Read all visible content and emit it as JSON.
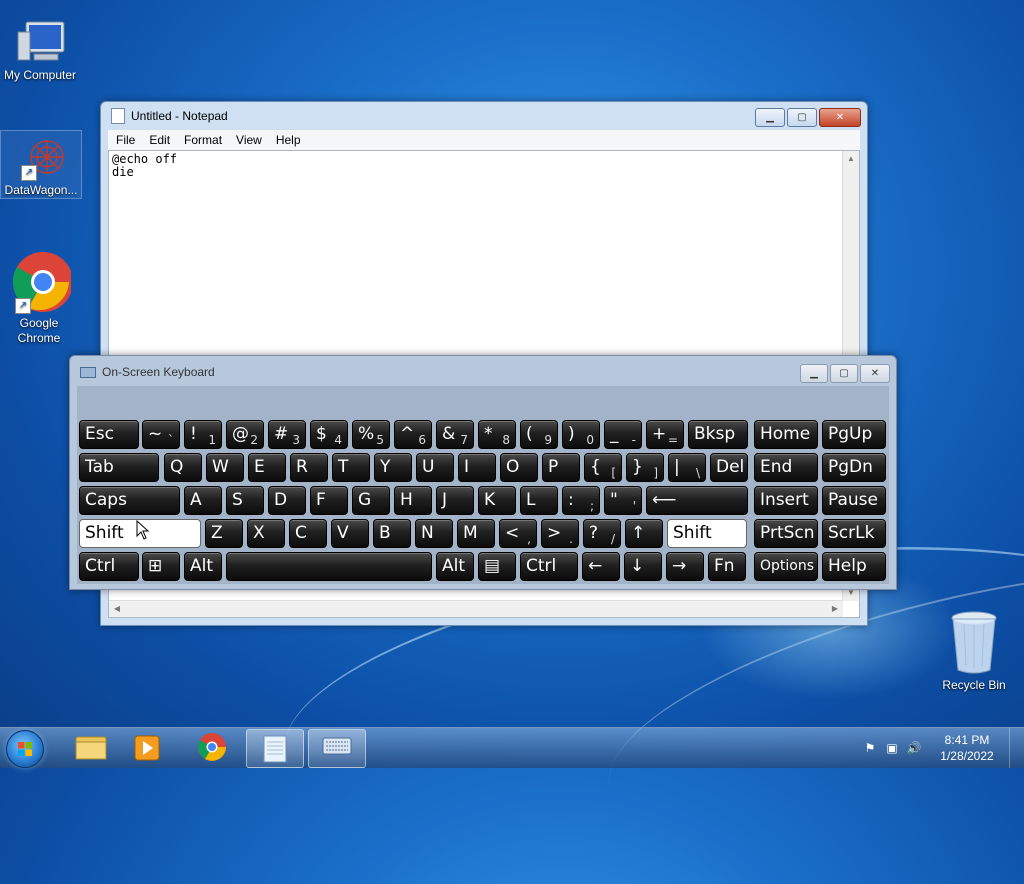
{
  "desktop": {
    "icons": [
      {
        "label": "My Computer"
      },
      {
        "label": "DataWagon..."
      },
      {
        "label": "Google Chrome"
      },
      {
        "label": "Recycle Bin"
      }
    ]
  },
  "notepad": {
    "title": "Untitled - Notepad",
    "menu": [
      "File",
      "Edit",
      "Format",
      "View",
      "Help"
    ],
    "content": "@echo off\ndie"
  },
  "osk": {
    "title": "On-Screen Keyboard",
    "rows": [
      [
        {
          "main": "Esc"
        },
        {
          "main": "~",
          "sub": "`"
        },
        {
          "main": "!",
          "sub": "1"
        },
        {
          "main": "@",
          "sub": "2"
        },
        {
          "main": "#",
          "sub": "3"
        },
        {
          "main": "$",
          "sub": "4"
        },
        {
          "main": "%",
          "sub": "5"
        },
        {
          "main": "^",
          "sub": "6"
        },
        {
          "main": "&",
          "sub": "7"
        },
        {
          "main": "*",
          "sub": "8"
        },
        {
          "main": "(",
          "sub": "9"
        },
        {
          "main": ")",
          "sub": "0"
        },
        {
          "main": "_",
          "sub": "-"
        },
        {
          "main": "+",
          "sub": "="
        },
        {
          "main": "Bksp"
        },
        {
          "main": "Home"
        },
        {
          "main": "PgUp"
        }
      ],
      [
        {
          "main": "Tab"
        },
        {
          "main": "Q"
        },
        {
          "main": "W"
        },
        {
          "main": "E"
        },
        {
          "main": "R"
        },
        {
          "main": "T"
        },
        {
          "main": "Y"
        },
        {
          "main": "U"
        },
        {
          "main": "I"
        },
        {
          "main": "O"
        },
        {
          "main": "P"
        },
        {
          "main": "{",
          "sub": "["
        },
        {
          "main": "}",
          "sub": "]"
        },
        {
          "main": "|",
          "sub": "\\"
        },
        {
          "main": "Del"
        },
        {
          "main": "End"
        },
        {
          "main": "PgDn"
        }
      ],
      [
        {
          "main": "Caps"
        },
        {
          "main": "A"
        },
        {
          "main": "S"
        },
        {
          "main": "D"
        },
        {
          "main": "F"
        },
        {
          "main": "G"
        },
        {
          "main": "H"
        },
        {
          "main": "J"
        },
        {
          "main": "K"
        },
        {
          "main": "L"
        },
        {
          "main": ":",
          "sub": ";"
        },
        {
          "main": "\"",
          "sub": "'"
        },
        {
          "main": "⟵"
        },
        {
          "main": "Insert"
        },
        {
          "main": "Pause"
        }
      ],
      [
        {
          "main": "Shift",
          "pressed": true
        },
        {
          "main": "Z"
        },
        {
          "main": "X"
        },
        {
          "main": "C"
        },
        {
          "main": "V"
        },
        {
          "main": "B"
        },
        {
          "main": "N"
        },
        {
          "main": "M"
        },
        {
          "main": "<",
          "sub": ","
        },
        {
          "main": ">",
          "sub": "."
        },
        {
          "main": "?",
          "sub": "/"
        },
        {
          "main": "↑"
        },
        {
          "main": "Shift",
          "pressed": true
        },
        {
          "main": "PrtScn"
        },
        {
          "main": "ScrLk"
        }
      ],
      [
        {
          "main": "Ctrl"
        },
        {
          "main": "⊞"
        },
        {
          "main": "Alt"
        },
        {
          "main": ""
        },
        {
          "main": "Alt"
        },
        {
          "main": "▤"
        },
        {
          "main": "Ctrl"
        },
        {
          "main": "←"
        },
        {
          "main": "↓"
        },
        {
          "main": "→"
        },
        {
          "main": "Fn"
        },
        {
          "main": "Options"
        },
        {
          "main": "Help"
        }
      ]
    ]
  },
  "taskbar": {
    "clock_time": "8:41 PM",
    "clock_date": "1/28/2022"
  }
}
